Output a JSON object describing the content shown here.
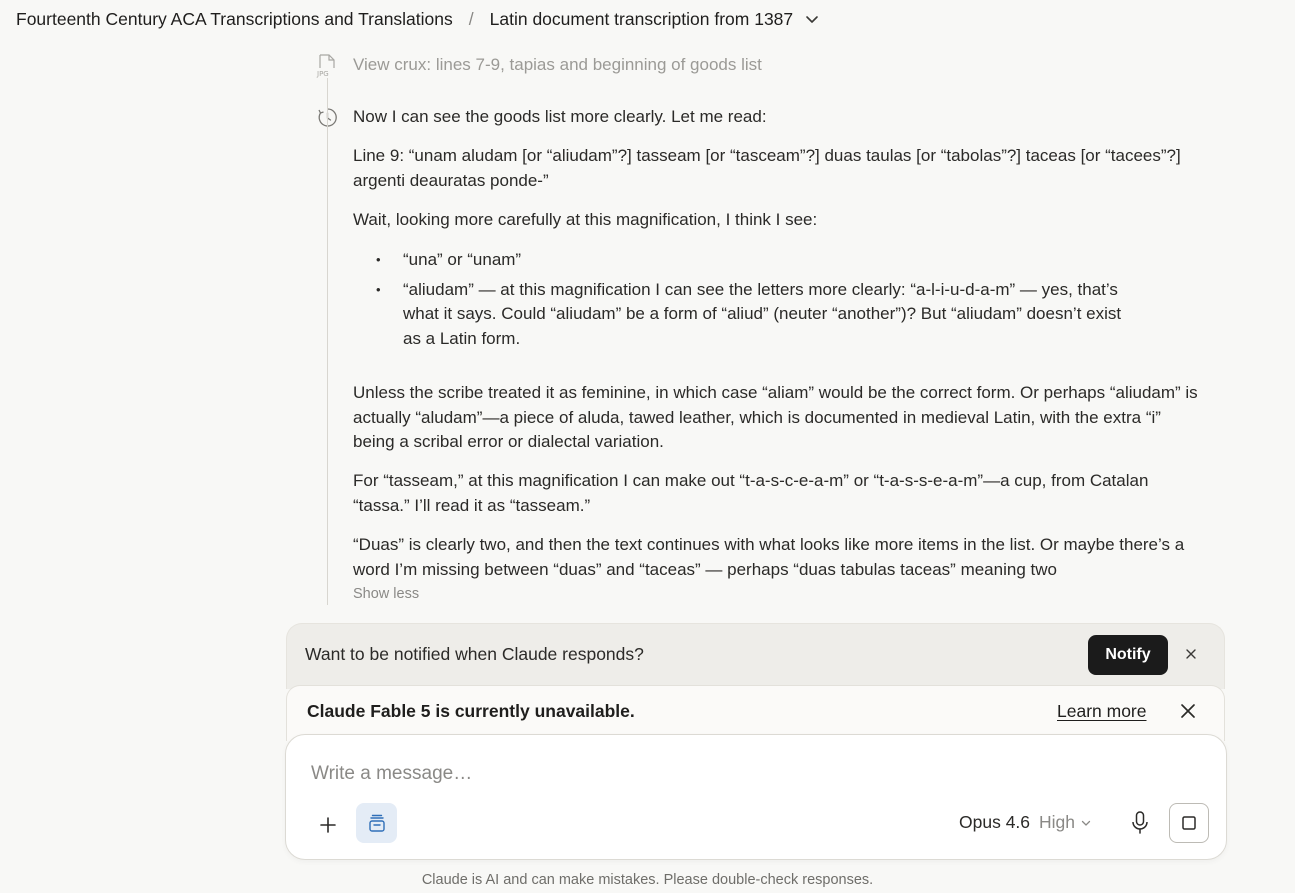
{
  "header": {
    "project": "Fourteenth Century ACA Transcriptions and Translations",
    "separator": "/",
    "chat_title": "Latin document transcription from 1387"
  },
  "thread": {
    "file_label": "View crux: lines 7-9, tapias and beginning of goods list",
    "paragraphs": [
      "Now I can see the goods list more clearly. Let me read:",
      "Line 9: “unam aludam [or “aliudam”?] tasseam [or “tasceam”?] duas taulas [or “tabolas”?] taceas [or “tacees”?] argenti deauratas ponde-”",
      "Wait, looking more carefully at this magnification, I think I see:"
    ],
    "bullets": [
      "“una” or “unam”",
      "“aliudam” — at this magnification I can see the letters more clearly: “a-l-i-u-d-a-m” — yes, that’s what it says. Could “aliudam” be a form of “aliud” (neuter “another”)? But “aliudam” doesn’t exist as a Latin form."
    ],
    "paragraphs_after": [
      "Unless the scribe treated it as feminine, in which case “aliam” would be the correct form. Or perhaps “aliudam” is actually “aludam”—a piece of aluda, tawed leather, which is documented in medieval Latin, with the extra “i” being a scribal error or dialectal variation.",
      "For “tasseam,” at this magnification I can make out “t-a-s-c-e-a-m” or “t-a-s-s-e-a-m”—a cup, from Catalan “tassa.” I’ll read it as “tasseam.”",
      "“Duas” is clearly two, and then the text continues with what looks like more items in the list. Or maybe there’s a word I’m missing between “duas” and “taceas” — perhaps “duas tabulas taceas” meaning two"
    ],
    "show_less": "Show less"
  },
  "notify": {
    "text": "Want to be notified when Claude responds?",
    "button": "Notify"
  },
  "unavailable": {
    "text": "Claude Fable 5 is currently unavailable.",
    "learn_more": "Learn more"
  },
  "composer": {
    "placeholder": "Write a message…",
    "model": "Opus 4.6",
    "effort": "High"
  },
  "disclaimer": "Claude is AI and can make mistakes. Please double-check responses.",
  "icons": [
    "file-jpg-icon",
    "clock-icon",
    "chevron-down-icon",
    "close-icon",
    "plus-icon",
    "tools-icon",
    "microphone-icon",
    "stop-icon"
  ]
}
